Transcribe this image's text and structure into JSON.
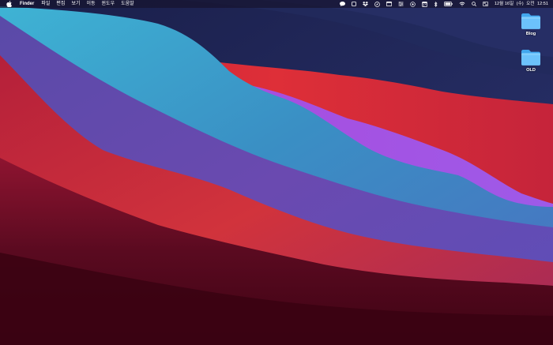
{
  "menubar": {
    "apple_icon": "apple-logo-icon",
    "app_name": "Finder",
    "menus": [
      "파일",
      "편집",
      "보기",
      "이동",
      "윈도우",
      "도움말"
    ],
    "status_icons": [
      "chat-bubble-icon",
      "square-icon",
      "dropbox-icon",
      "compass-icon",
      "window-icon",
      "control-sliders-icon",
      "target-icon",
      "calendar-icon",
      "bluetooth-icon",
      "battery-icon",
      "wifi-icon",
      "search-icon",
      "control-center-icon"
    ],
    "clock": {
      "date": "12월 16일",
      "weekday": "(수)",
      "period": "오전",
      "time": "12:51"
    }
  },
  "desktop_icons": [
    {
      "label": "Blog",
      "icon": "folder-icon"
    },
    {
      "label": "OLD",
      "icon": "folder-icon"
    }
  ],
  "colors": {
    "menubar_bg": "#16142e",
    "folder_light": "#8fd3ff",
    "folder_dark": "#42a7ee",
    "wallpaper_navy": "#1d2250",
    "wallpaper_red": "#d6303e",
    "wallpaper_purple": "#b055e0",
    "wallpaper_teal": "#36a9cc",
    "wallpaper_maroon": "#4a0418"
  }
}
